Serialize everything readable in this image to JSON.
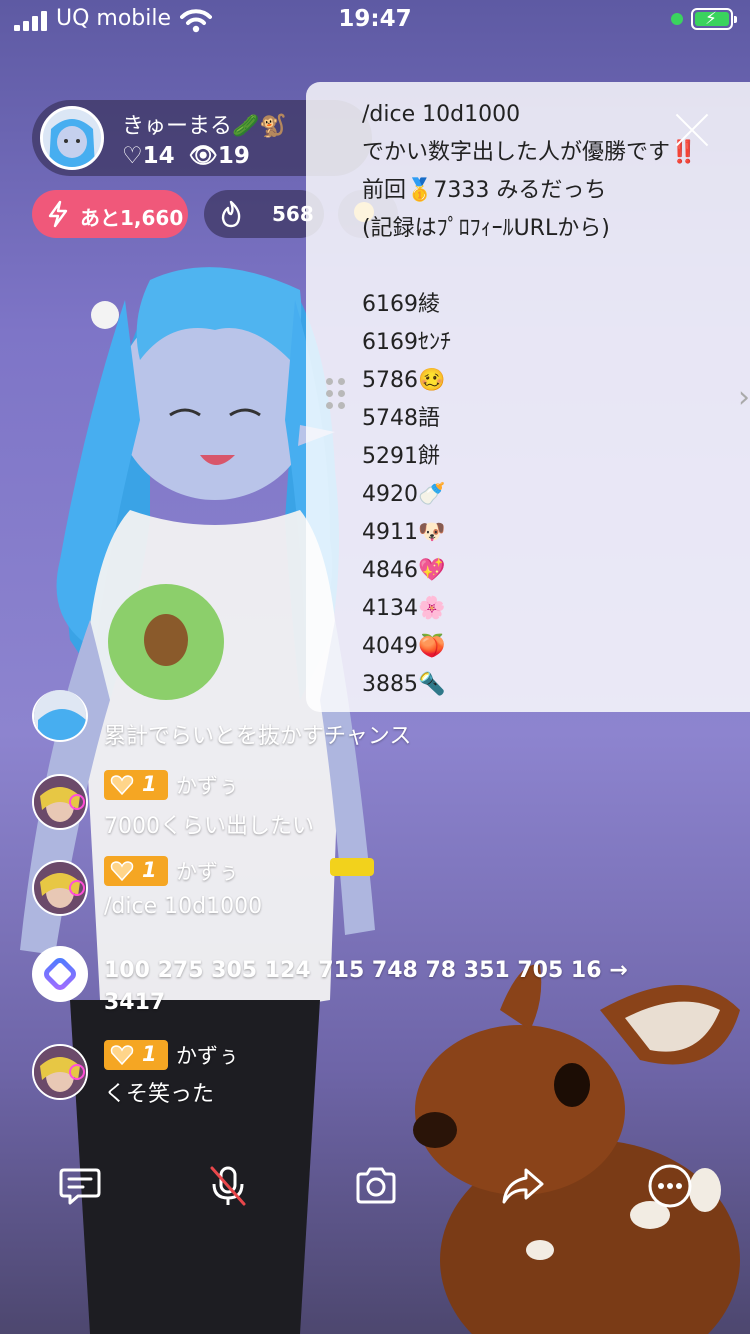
{
  "status_bar": {
    "carrier": "UQ mobile",
    "time": "19:47"
  },
  "host": {
    "name": "きゅーまる🥒🐒",
    "likes": "♡14",
    "viewers": "👁19"
  },
  "pills": {
    "remaining": "あと1,660",
    "fire": "568"
  },
  "memo": {
    "lines": [
      "/dice 10d1000",
      "でかい数字出した人が優勝です‼️",
      "前回🥇7333 みるだっち",
      "(記録はﾌﾟﾛﾌｨｰﾙURLから)",
      "",
      "6169綾",
      "6169ｾﾝﾁ",
      "5786🥴",
      "5748語",
      "5291餅",
      "4920🍼",
      "4911🐶",
      "4846💖",
      "4134🌸",
      "4049🍑",
      "3885🔦"
    ]
  },
  "chat": [
    {
      "type": "text",
      "text": "累計でらいとを抜かすチャンス"
    },
    {
      "type": "user",
      "level": "1",
      "user": "かずぅ",
      "text": "7000くらい出したい"
    },
    {
      "type": "user",
      "level": "1",
      "user": "かずぅ",
      "text": "/dice 10d1000"
    },
    {
      "type": "system",
      "text_line1": "100 275 305 124 715 748 78 351 705 16 →",
      "text_line2": "3417"
    },
    {
      "type": "user",
      "level": "1",
      "user": "かずぅ",
      "text": "くそ笑った"
    }
  ],
  "toolbar": [
    "comment-icon",
    "mic-muted-icon",
    "camera-icon",
    "share-icon",
    "more-icon"
  ],
  "colors": {
    "accent_pink": "#f0587a",
    "badge_orange": "#f5a623",
    "battery_green": "#3ad35e"
  }
}
